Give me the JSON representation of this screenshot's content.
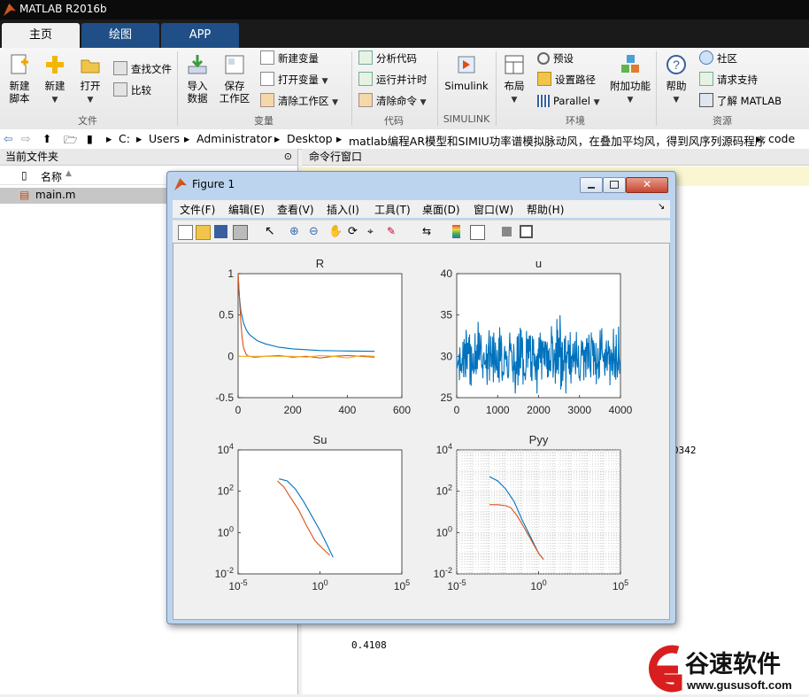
{
  "app": {
    "title": "MATLAB R2016b"
  },
  "tabs": [
    "主页",
    "绘图",
    "APP"
  ],
  "ribbon": {
    "file": {
      "label": "文件",
      "new_script": "新建\n脚本",
      "new_script_a": "新建",
      "new_script_b": "脚本",
      "new": "新建",
      "open": "打开",
      "find_files": "查找文件",
      "compare": "比较"
    },
    "variable": {
      "label": "变量",
      "import_a": "导入",
      "import_b": "数据",
      "save_a": "保存",
      "save_b": "工作区",
      "new_var": "新建变量",
      "open_var": "打开变量",
      "clear_ws": "清除工作区"
    },
    "code": {
      "label": "代码",
      "analyze": "分析代码",
      "run_time": "运行并计时",
      "clear_cmd": "清除命令"
    },
    "simulink": {
      "label": "SIMULINK",
      "btn": "Simulink"
    },
    "env": {
      "label": "环境",
      "layout": "布局",
      "prefs": "预设",
      "set_path": "设置路径",
      "parallel": "Parallel",
      "addons": "附加功能"
    },
    "resources": {
      "label": "资源",
      "help": "帮助",
      "community": "社区",
      "support": "请求支持",
      "learn": "了解 MATLAB"
    }
  },
  "address": {
    "parts": [
      "C:",
      "Users",
      "Administrator",
      "Desktop",
      "matlab编程AR模型和SIMIU功率谱模拟脉动风，在叠加平均风，得到风序列源码程序",
      "code"
    ]
  },
  "current_folder": {
    "header": "当前文件夹",
    "col_name": "名称",
    "files": [
      "main.m"
    ]
  },
  "command_window": {
    "header": "命令行窗口",
    "values": [
      "0342",
      "0.4108"
    ]
  },
  "figure": {
    "title": "Figure 1",
    "menu": [
      "文件(F)",
      "编辑(E)",
      "查看(V)",
      "插入(I)",
      "工具(T)",
      "桌面(D)",
      "窗口(W)",
      "帮助(H)"
    ]
  },
  "chart_data": [
    {
      "type": "line",
      "title": "R",
      "xlim": [
        0,
        600
      ],
      "ylim": [
        -0.5,
        1
      ],
      "xticks": [
        "0",
        "200",
        "400",
        "600"
      ],
      "yticks": [
        "-0.5",
        "0",
        "0.5",
        "1"
      ],
      "series": [
        {
          "color": "#0072bd",
          "x": [
            0,
            5,
            10,
            20,
            30,
            40,
            50,
            70,
            100,
            150,
            200,
            300,
            400,
            500
          ],
          "y": [
            1,
            0.72,
            0.55,
            0.4,
            0.32,
            0.27,
            0.24,
            0.19,
            0.15,
            0.11,
            0.09,
            0.07,
            0.065,
            0.06
          ]
        },
        {
          "color": "#d95319",
          "x": [
            0,
            5,
            10,
            15,
            20,
            30,
            40,
            60,
            100,
            150,
            200,
            250,
            300,
            350,
            400,
            450,
            500
          ],
          "y": [
            1,
            0.7,
            0.42,
            0.22,
            0.1,
            0.02,
            0.0,
            -0.01,
            0.0,
            0.01,
            -0.01,
            0.0,
            -0.02,
            0.0,
            0.01,
            0.0,
            -0.01
          ]
        },
        {
          "color": "#edb120",
          "x": [
            0,
            100,
            200,
            250,
            300,
            350,
            400,
            450,
            500
          ],
          "y": [
            0.0,
            0.0,
            0.0,
            -0.01,
            0.01,
            0.0,
            -0.02,
            0.01,
            0.0
          ]
        }
      ]
    },
    {
      "type": "line",
      "title": "u",
      "xlim": [
        0,
        4000
      ],
      "ylim": [
        25,
        40
      ],
      "xticks": [
        "0",
        "1000",
        "2000",
        "3000",
        "4000"
      ],
      "yticks": [
        "25",
        "30",
        "35",
        "40"
      ],
      "series": [
        {
          "color": "#0072bd",
          "noise": true,
          "mean": 30,
          "n": 4000
        }
      ]
    },
    {
      "type": "line",
      "title": "Su",
      "log": true,
      "xlim": [
        -5,
        5
      ],
      "ylim": [
        -2,
        4
      ],
      "xticks": [
        "10-5",
        "100",
        "105"
      ],
      "yticks": [
        "10-2",
        "100",
        "102",
        "104"
      ],
      "series": [
        {
          "color": "#0072bd",
          "x": [
            -2.5,
            -2.0,
            -1.5,
            -1.0,
            -0.5,
            0.0,
            0.5,
            0.8
          ],
          "y": [
            2.6,
            2.5,
            2.1,
            1.5,
            0.8,
            0.1,
            -0.7,
            -1.2
          ]
        },
        {
          "color": "#d95319",
          "x": [
            -2.6,
            -2.2,
            -1.8,
            -1.3,
            -0.8,
            -0.3,
            0.2,
            0.6
          ],
          "y": [
            2.5,
            2.2,
            1.7,
            1.1,
            0.3,
            -0.4,
            -0.8,
            -1.1
          ]
        }
      ]
    },
    {
      "type": "line",
      "title": "Pyy",
      "log": true,
      "grid": true,
      "xlim": [
        -5,
        5
      ],
      "ylim": [
        -2,
        4
      ],
      "xticks": [
        "10-5",
        "100",
        "105"
      ],
      "yticks": [
        "10-2",
        "100",
        "102",
        "104"
      ],
      "series": [
        {
          "color": "#0072bd",
          "x": [
            -3,
            -2.5,
            -2.0,
            -1.5,
            -1.0,
            -0.5,
            0.0,
            0.3
          ],
          "y": [
            2.7,
            2.5,
            2.1,
            1.5,
            0.6,
            -0.2,
            -1.0,
            -1.3
          ]
        },
        {
          "color": "#d95319",
          "x": [
            -3,
            -2.5,
            -2.0,
            -1.7,
            -1.3,
            -1.0,
            -0.5,
            0.0,
            0.3
          ],
          "y": [
            1.35,
            1.35,
            1.3,
            1.2,
            0.8,
            0.4,
            -0.3,
            -1.0,
            -1.3
          ]
        }
      ]
    }
  ],
  "watermark": {
    "name": "谷速软件",
    "url": "www.gususoft.com"
  }
}
